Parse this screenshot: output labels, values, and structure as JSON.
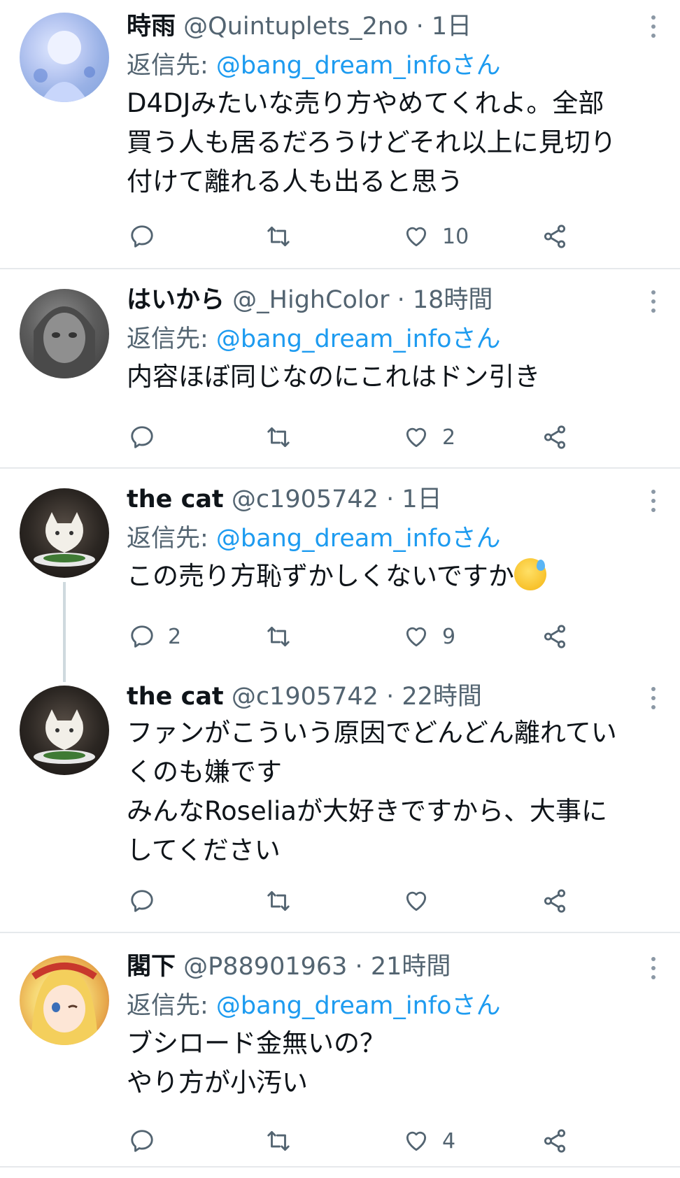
{
  "tweets": [
    {
      "name": "時雨",
      "handle": "@Quintuplets_2no",
      "time": "1日",
      "reply_label": "返信先: ",
      "reply_mention": "@bang_dream_infoさん",
      "lines": [
        "D4DJみたいな売り方やめてくれよ。全部",
        "買う人も居るだろうけどそれ以上に見切り",
        "付けて離れる人も出ると思う"
      ],
      "reply_count": "",
      "retweet_count": "",
      "like_count": "10"
    },
    {
      "name": "はいから",
      "handle": "@_HighColor",
      "time": "18時間",
      "reply_label": "返信先: ",
      "reply_mention": "@bang_dream_infoさん",
      "lines": [
        "内容ほぼ同じなのにこれはドン引き"
      ],
      "reply_count": "",
      "retweet_count": "",
      "like_count": "2"
    },
    {
      "name": "the cat",
      "handle": "@c1905742",
      "time": "1日",
      "reply_label": "返信先: ",
      "reply_mention": "@bang_dream_infoさん",
      "lines": [
        "この売り方恥ずかしくないですか"
      ],
      "emoji": "sweat-smile-emoji",
      "reply_count": "2",
      "retweet_count": "",
      "like_count": "9"
    },
    {
      "name": "the cat",
      "handle": "@c1905742",
      "time": "22時間",
      "lines": [
        "ファンがこういう原因でどんどん離れてい",
        "くのも嫌です",
        "みんなRoseliaが大好きですから、大事に",
        "してください"
      ],
      "reply_count": "",
      "retweet_count": "",
      "like_count": ""
    },
    {
      "name": "閣下",
      "handle": "@P88901963",
      "time": "21時間",
      "reply_label": "返信先: ",
      "reply_mention": "@bang_dream_infoさん",
      "lines": [
        "ブシロード金無いの？",
        "やり方が小汚い"
      ],
      "reply_count": "",
      "retweet_count": "",
      "like_count": "4"
    }
  ],
  "separator": " · ",
  "colors": {
    "text": "#0f1419",
    "secondary": "#536471",
    "link": "#1d9bf0",
    "divider": "#e6e9ec",
    "thread_line": "#cfd9de"
  },
  "icons": [
    "more-icon",
    "reply-icon",
    "retweet-icon",
    "like-icon",
    "share-icon"
  ]
}
